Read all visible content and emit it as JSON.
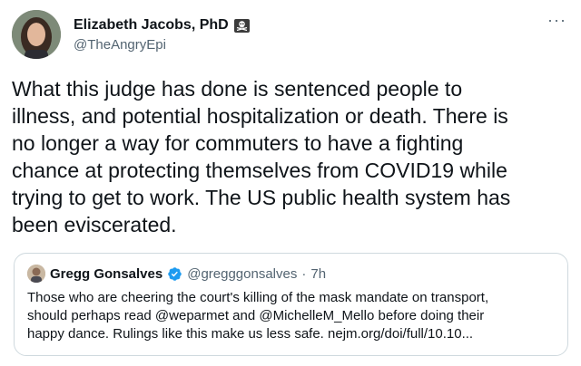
{
  "tweet": {
    "author": {
      "display_name": "Elizabeth Jacobs, PhD",
      "handle": "@TheAngryEpi",
      "badge_icon": "skull-crossbones-icon"
    },
    "more_label": "···",
    "text": "What this judge has done is sentenced people to\nillness, and potential hospitalization or death. There is\nno longer a way for commuters to have a fighting\nchance at protecting themselves from COVID19 while\ntrying to get to work. The US public health system has\nbeen eviscerated."
  },
  "quote": {
    "author": {
      "display_name": "Gregg Gonsalves",
      "handle": "@gregggonsalves",
      "separator": "·",
      "time": "7h",
      "verified_icon": "verified-badge-icon"
    },
    "text": "Those who are cheering the court's killing of the mask mandate on transport,\nshould perhaps read @weparmet and @MichelleM_Mello before doing their\nhappy dance. Rulings like this make us less safe. nejm.org/doi/full/10.10..."
  },
  "colors": {
    "text_primary": "#0f1419",
    "text_secondary": "#536471",
    "border": "#cfd9de",
    "verified_blue": "#1d9bf0"
  }
}
